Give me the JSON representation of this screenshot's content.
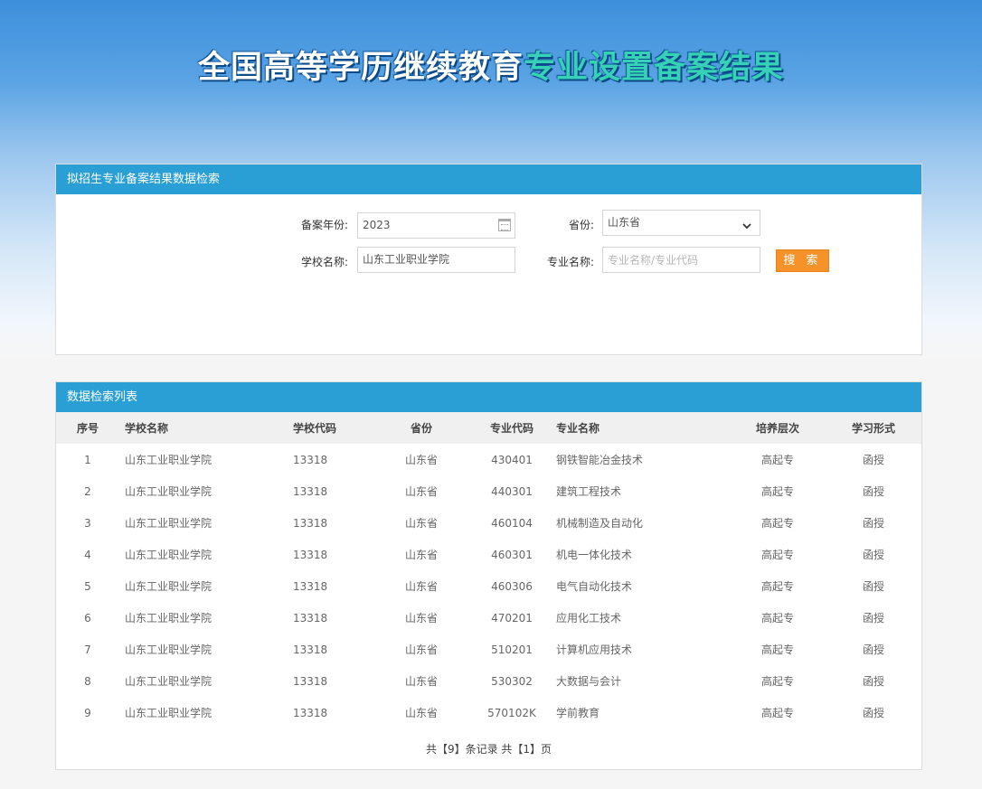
{
  "hero": {
    "title_part1": "全国高等学历继续教育",
    "title_part2": "专业设置备案结果"
  },
  "search": {
    "panel_title": "拟招生专业备案结果数据检索",
    "year_label": "备案年份:",
    "year_value": "2023",
    "province_label": "省份:",
    "province_value": "山东省",
    "school_label": "学校名称:",
    "school_value": "山东工业职业学院",
    "major_label": "专业名称:",
    "major_placeholder": "专业名称/专业代码",
    "search_button": "搜 索"
  },
  "list": {
    "panel_title": "数据检索列表",
    "columns": [
      "序号",
      "学校名称",
      "学校代码",
      "省份",
      "专业代码",
      "专业名称",
      "培养层次",
      "学习形式"
    ],
    "rows": [
      [
        "1",
        "山东工业职业学院",
        "13318",
        "山东省",
        "430401",
        "钢铁智能冶金技术",
        "高起专",
        "函授"
      ],
      [
        "2",
        "山东工业职业学院",
        "13318",
        "山东省",
        "440301",
        "建筑工程技术",
        "高起专",
        "函授"
      ],
      [
        "3",
        "山东工业职业学院",
        "13318",
        "山东省",
        "460104",
        "机械制造及自动化",
        "高起专",
        "函授"
      ],
      [
        "4",
        "山东工业职业学院",
        "13318",
        "山东省",
        "460301",
        "机电一体化技术",
        "高起专",
        "函授"
      ],
      [
        "5",
        "山东工业职业学院",
        "13318",
        "山东省",
        "460306",
        "电气自动化技术",
        "高起专",
        "函授"
      ],
      [
        "6",
        "山东工业职业学院",
        "13318",
        "山东省",
        "470201",
        "应用化工技术",
        "高起专",
        "函授"
      ],
      [
        "7",
        "山东工业职业学院",
        "13318",
        "山东省",
        "510201",
        "计算机应用技术",
        "高起专",
        "函授"
      ],
      [
        "8",
        "山东工业职业学院",
        "13318",
        "山东省",
        "530302",
        "大数据与会计",
        "高起专",
        "函授"
      ],
      [
        "9",
        "山东工业职业学院",
        "13318",
        "山东省",
        "570102K",
        "学前教育",
        "高起专",
        "函授"
      ]
    ],
    "pager": "共【9】条记录 共【1】页"
  }
}
